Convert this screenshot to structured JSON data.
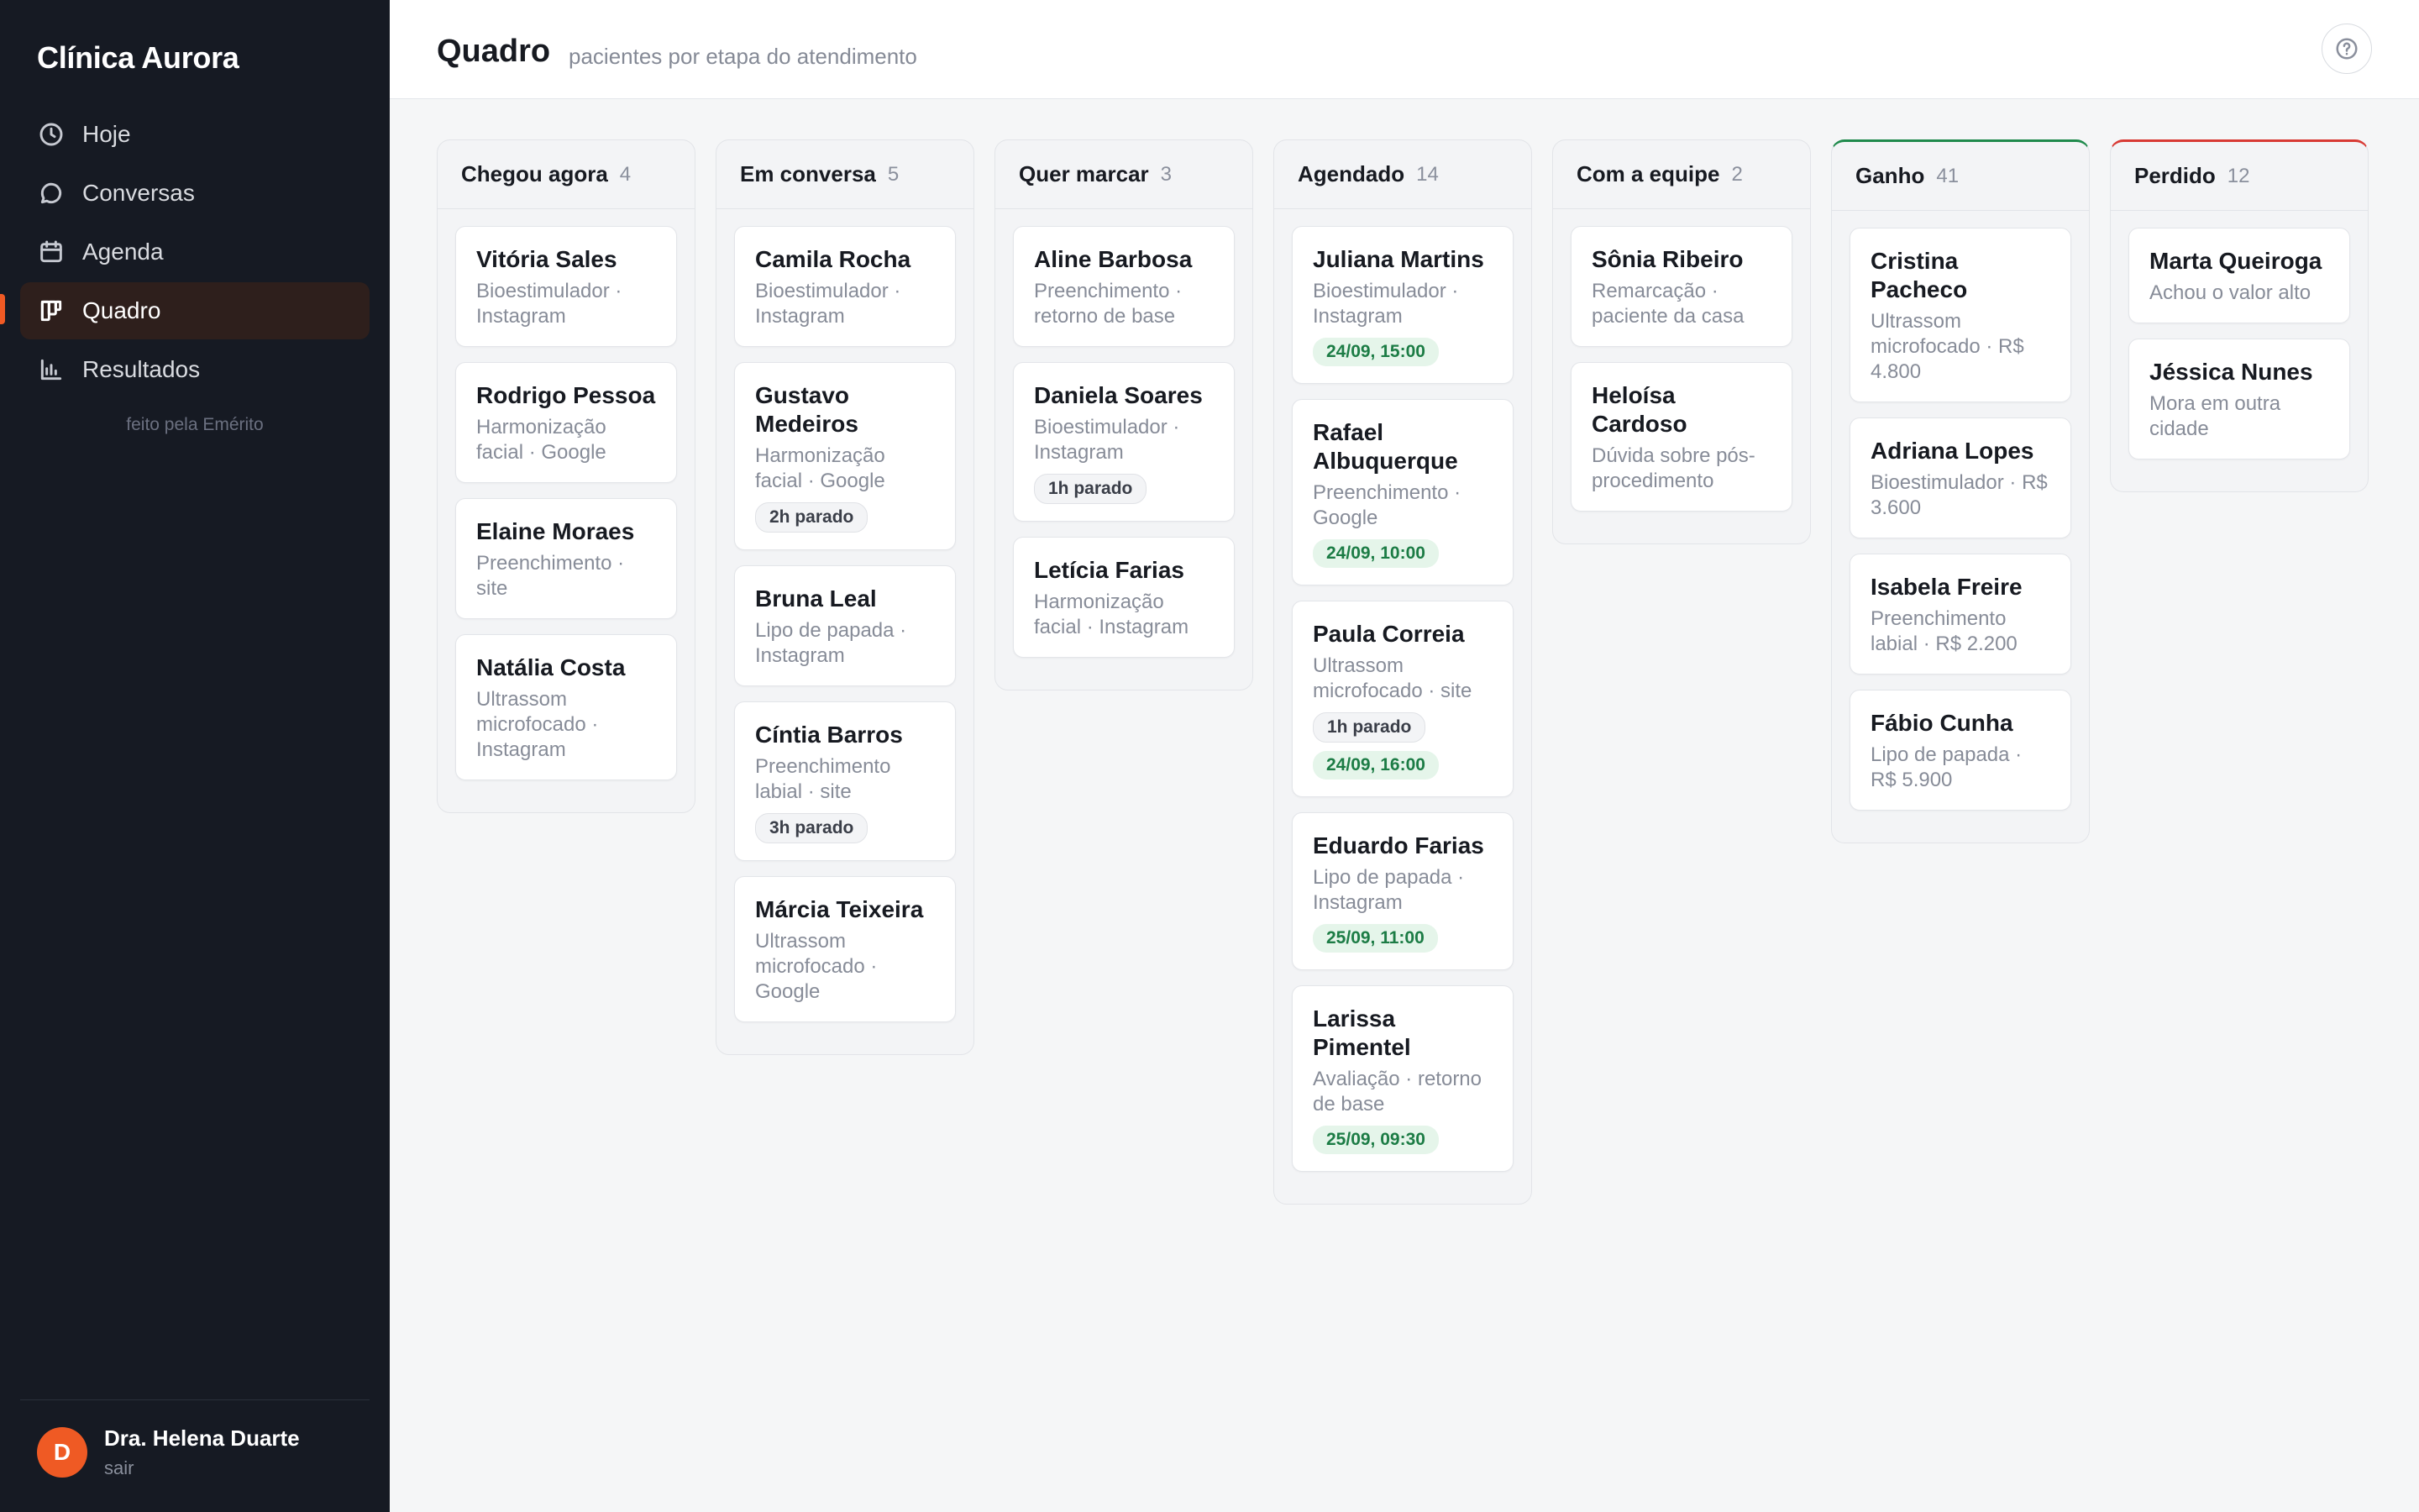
{
  "app": {
    "brand": "Clínica Aurora",
    "credit": "feito pela Emérito"
  },
  "sidebar": {
    "items": [
      {
        "label": "Hoje",
        "icon": "clock-icon",
        "active": false
      },
      {
        "label": "Conversas",
        "icon": "chat-bubble-icon",
        "active": false
      },
      {
        "label": "Agenda",
        "icon": "calendar-icon",
        "active": false
      },
      {
        "label": "Quadro",
        "icon": "kanban-icon",
        "active": true
      },
      {
        "label": "Resultados",
        "icon": "bar-chart-icon",
        "active": false
      }
    ]
  },
  "user": {
    "initial": "D",
    "name": "Dra. Helena Duarte",
    "action": "sair"
  },
  "header": {
    "title": "Quadro",
    "subtitle": "pacientes por etapa do atendimento",
    "help_icon": "help-circle-icon"
  },
  "colors": {
    "accent": "#f05a24",
    "won": "#1f8a4c",
    "lost": "#d83a34",
    "sidebar_bg": "#161a23"
  },
  "board": {
    "columns": [
      {
        "title": "Chegou agora",
        "count": "4",
        "cards": [
          {
            "name": "Vitória Sales",
            "meta": "Bioestimulador · Instagram",
            "tags": []
          },
          {
            "name": "Rodrigo Pessoa",
            "meta": "Harmonização facial · Google",
            "tags": []
          },
          {
            "name": "Elaine Moraes",
            "meta": "Preenchimento · site",
            "tags": []
          },
          {
            "name": "Natália Costa",
            "meta": "Ultrassom microfocado · Instagram",
            "tags": []
          }
        ]
      },
      {
        "title": "Em conversa",
        "count": "5",
        "cards": [
          {
            "name": "Camila Rocha",
            "meta": "Bioestimulador · Instagram",
            "tags": []
          },
          {
            "name": "Gustavo Medeiros",
            "meta": "Harmonização facial · Google",
            "tags": [
              {
                "type": "idle",
                "text": "2h parado"
              }
            ]
          },
          {
            "name": "Bruna Leal",
            "meta": "Lipo de papada · Instagram",
            "tags": []
          },
          {
            "name": "Cíntia Barros",
            "meta": "Preenchimento labial · site",
            "tags": [
              {
                "type": "idle",
                "text": "3h parado"
              }
            ]
          },
          {
            "name": "Márcia Teixeira",
            "meta": "Ultrassom microfocado · Google",
            "tags": []
          }
        ]
      },
      {
        "title": "Quer marcar",
        "count": "3",
        "cards": [
          {
            "name": "Aline Barbosa",
            "meta": "Preenchimento · retorno de base",
            "tags": []
          },
          {
            "name": "Daniela Soares",
            "meta": "Bioestimulador · Instagram",
            "tags": [
              {
                "type": "idle",
                "text": "1h parado"
              }
            ]
          },
          {
            "name": "Letícia Farias",
            "meta": "Harmonização facial · Instagram",
            "tags": []
          }
        ]
      },
      {
        "title": "Agendado",
        "count": "14",
        "cards": [
          {
            "name": "Juliana Martins",
            "meta": "Bioestimulador · Instagram",
            "tags": [
              {
                "type": "date",
                "text": "24/09, 15:00"
              }
            ]
          },
          {
            "name": "Rafael Albuquerque",
            "meta": "Preenchimento · Google",
            "tags": [
              {
                "type": "date",
                "text": "24/09, 10:00"
              }
            ]
          },
          {
            "name": "Paula Correia",
            "meta": "Ultrassom microfocado · site",
            "tags": [
              {
                "type": "idle",
                "text": "1h parado"
              },
              {
                "type": "date",
                "text": "24/09, 16:00"
              }
            ]
          },
          {
            "name": "Eduardo Farias",
            "meta": "Lipo de papada · Instagram",
            "tags": [
              {
                "type": "date",
                "text": "25/09, 11:00"
              }
            ]
          },
          {
            "name": "Larissa Pimentel",
            "meta": "Avaliação · retorno de base",
            "tags": [
              {
                "type": "date",
                "text": "25/09, 09:30"
              }
            ]
          }
        ]
      },
      {
        "title": "Com a equipe",
        "count": "2",
        "cards": [
          {
            "name": "Sônia Ribeiro",
            "meta": "Remarcação · paciente da casa",
            "tags": []
          },
          {
            "name": "Heloísa Cardoso",
            "meta": "Dúvida sobre pós-procedimento",
            "tags": []
          }
        ]
      },
      {
        "title": "Ganho",
        "count": "41",
        "variant": "won",
        "cards": [
          {
            "name": "Cristina Pacheco",
            "meta": "Ultrassom microfocado · R$ 4.800",
            "tags": []
          },
          {
            "name": "Adriana Lopes",
            "meta": "Bioestimulador · R$ 3.600",
            "tags": []
          },
          {
            "name": "Isabela Freire",
            "meta": "Preenchimento labial · R$ 2.200",
            "tags": []
          },
          {
            "name": "Fábio Cunha",
            "meta": "Lipo de papada · R$ 5.900",
            "tags": []
          }
        ]
      },
      {
        "title": "Perdido",
        "count": "12",
        "variant": "lost",
        "cards": [
          {
            "name": "Marta Queiroga",
            "meta": "Achou o valor alto",
            "tags": []
          },
          {
            "name": "Jéssica Nunes",
            "meta": "Mora em outra cidade",
            "tags": []
          }
        ]
      }
    ]
  }
}
